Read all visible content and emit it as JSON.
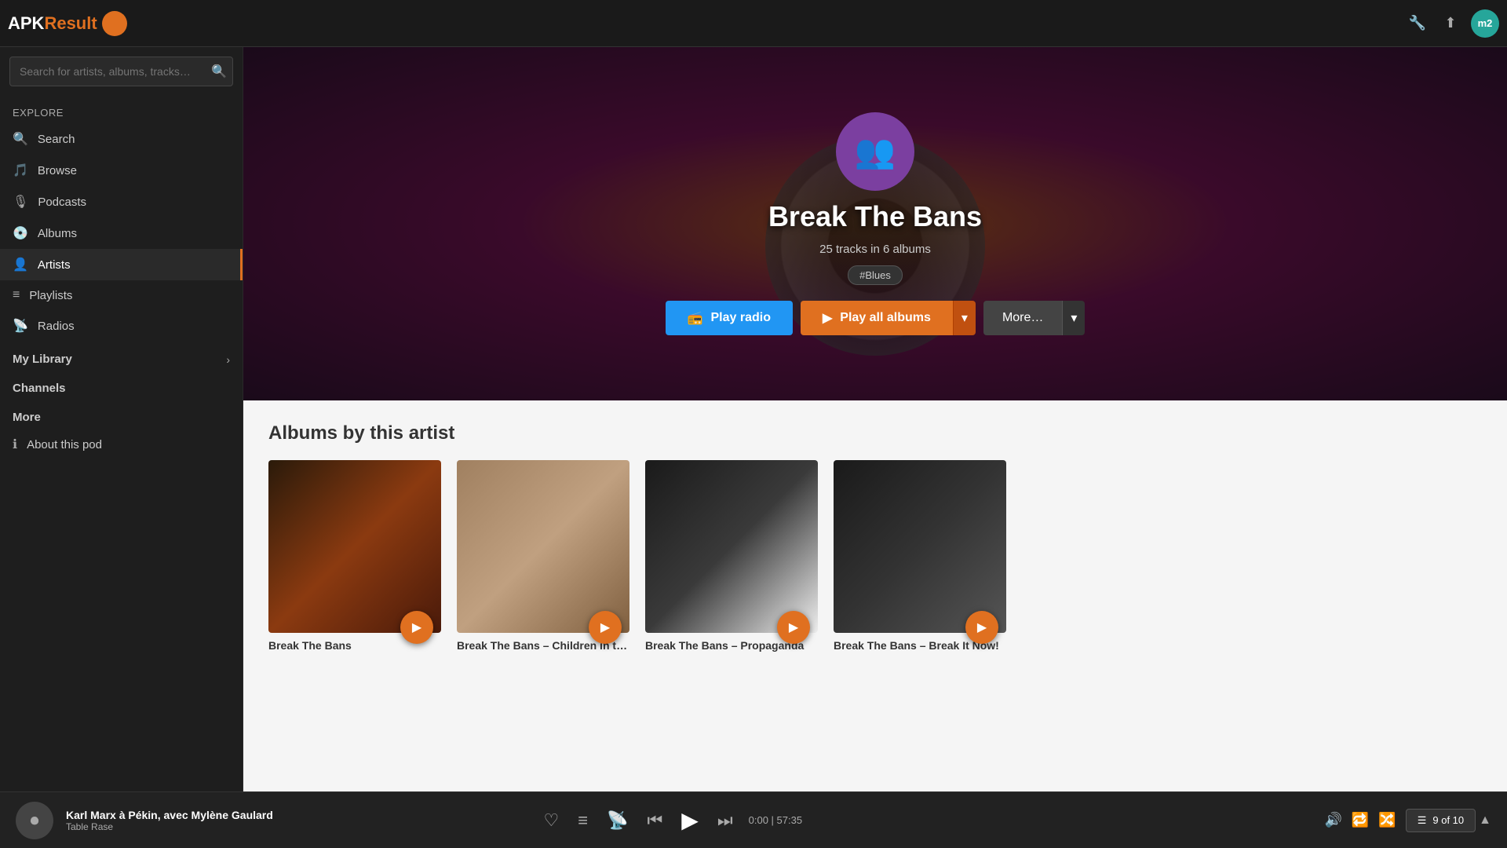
{
  "app": {
    "logo_apk": "APK",
    "logo_result": "Result"
  },
  "topbar": {
    "avatar_label": "m2",
    "avatar_bg": "#26a69a"
  },
  "search": {
    "placeholder": "Search for artists, albums, tracks…"
  },
  "sidebar": {
    "explore_label": "Explore",
    "items": [
      {
        "id": "search",
        "label": "Search",
        "icon": "🔍"
      },
      {
        "id": "browse",
        "label": "Browse",
        "icon": "🎵"
      },
      {
        "id": "podcasts",
        "label": "Podcasts",
        "icon": "🎙"
      },
      {
        "id": "albums",
        "label": "Albums",
        "icon": "💿"
      },
      {
        "id": "artists",
        "label": "Artists",
        "icon": "👤",
        "active": true
      },
      {
        "id": "playlists",
        "label": "Playlists",
        "icon": "≡"
      },
      {
        "id": "radios",
        "label": "Radios",
        "icon": "📡"
      }
    ],
    "my_library_label": "My Library",
    "channels_label": "Channels",
    "more_label": "More",
    "about_label": "About this pod"
  },
  "artist": {
    "name": "Break The Bans",
    "track_count": "25 tracks in 6 albums",
    "tag": "#Blues",
    "avatar_icon": "👥"
  },
  "buttons": {
    "play_radio": "Play radio",
    "play_all_albums": "Play all albums",
    "more": "More…"
  },
  "albums_section": {
    "title": "Albums by this artist",
    "albums": [
      {
        "id": 1,
        "title": "Break The Bans",
        "art_class": "art-1"
      },
      {
        "id": 2,
        "title": "Break The Bans – Children in the gloom",
        "art_class": "art-2"
      },
      {
        "id": 3,
        "title": "Break The Bans – Propaganda",
        "art_class": "art-3"
      },
      {
        "id": 4,
        "title": "Break The Bans – Break It Now!",
        "art_class": "art-4"
      }
    ]
  },
  "player": {
    "track": "Karl Marx à Pékin, avec Mylène Gaulard",
    "album": "Table Rase",
    "time_current": "0:00",
    "time_total": "57:35",
    "time_display": "0:00 | 57:35",
    "queue_label": "9 of 10"
  }
}
